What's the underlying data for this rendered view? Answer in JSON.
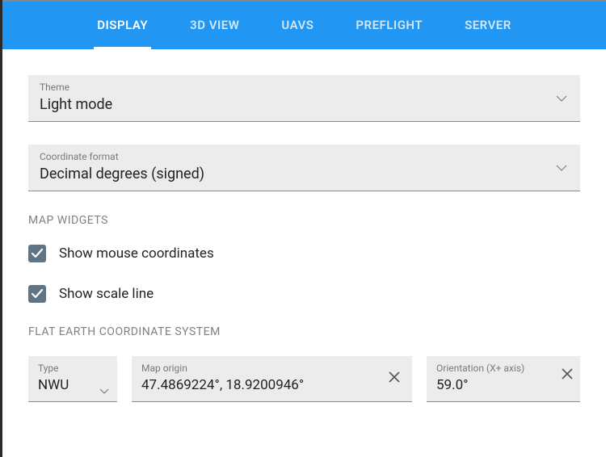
{
  "tabs": {
    "display": "DISPLAY",
    "view3d": "3D VIEW",
    "uavs": "UAVS",
    "preflight": "PREFLIGHT",
    "server": "SERVER"
  },
  "theme": {
    "label": "Theme",
    "value": "Light mode"
  },
  "coordFormat": {
    "label": "Coordinate format",
    "value": "Decimal degrees (signed)"
  },
  "sections": {
    "mapWidgets": "MAP WIDGETS",
    "flatEarth": "FLAT EARTH COORDINATE SYSTEM"
  },
  "checkboxes": {
    "showMouse": "Show mouse coordinates",
    "showScale": "Show scale line"
  },
  "flatEarth": {
    "typeLabel": "Type",
    "typeValue": "NWU",
    "originLabel": "Map origin",
    "originValue": "47.4869224°, 18.9200946°",
    "orientLabel": "Orientation (X+ axis)",
    "orientValue": "59.0°"
  }
}
